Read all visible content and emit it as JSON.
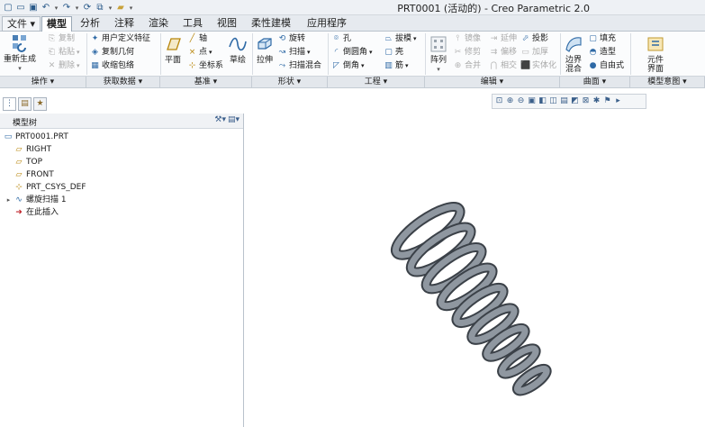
{
  "window": {
    "title": "PRT0001 (活动的) - Creo Parametric 2.0"
  },
  "quick_access": {
    "icons": [
      "new-icon",
      "open-icon",
      "save-icon",
      "undo-icon",
      "redo-icon",
      "regenerate-icon",
      "windows-icon",
      "close-icon"
    ]
  },
  "tabs": [
    {
      "label": "文件",
      "id": "file"
    },
    {
      "label": "模型",
      "id": "model"
    },
    {
      "label": "分析",
      "id": "analysis"
    },
    {
      "label": "注释",
      "id": "annotate"
    },
    {
      "label": "渲染",
      "id": "render"
    },
    {
      "label": "工具",
      "id": "tools"
    },
    {
      "label": "视图",
      "id": "view"
    },
    {
      "label": "柔性建模",
      "id": "flex"
    },
    {
      "label": "应用程序",
      "id": "apps"
    }
  ],
  "ribbon": {
    "operations": {
      "regenerate": "重新生成",
      "copy": "复制",
      "paste": "粘贴",
      "delete": "删除",
      "group_label": "操作"
    },
    "get_data": {
      "udf": "用户定义特征",
      "copy_geom": "复制几何",
      "shrinkwrap": "收缩包络",
      "group_label": "获取数据"
    },
    "datum": {
      "plane": "平面",
      "axis": "轴",
      "point": "点",
      "csys": "坐标系",
      "sketch": "草绘",
      "group_label": "基准"
    },
    "shapes": {
      "extrude": "拉伸",
      "revolve": "旋转",
      "sweep": "扫描",
      "swept_blend": "扫描混合",
      "group_label": "形状"
    },
    "engineering": {
      "hole": "孔",
      "round": "倒圆角",
      "chamfer": "倒角",
      "draft": "拔模",
      "shell": "壳",
      "rib": "筋",
      "group_label": "工程"
    },
    "editing": {
      "pattern": "阵列",
      "mirror": "镜像",
      "trim": "修剪",
      "merge": "合并",
      "extend": "延伸",
      "offset": "偏移",
      "intersect": "相交",
      "project": "投影",
      "thicken": "加厚",
      "solidify": "实体化",
      "group_label": "编辑"
    },
    "surfaces": {
      "boundary_blend": "边界混合",
      "fill": "填充",
      "style": "造型",
      "freestyle": "自由式",
      "group_label": "曲面"
    },
    "model_intent": {
      "component_interface": "元件界面",
      "group_label": "模型意图"
    }
  },
  "left_panel": {
    "tree_header": "模型树",
    "nodes": [
      {
        "label": "PRT0001.PRT",
        "icon": "part-icon"
      },
      {
        "label": "RIGHT",
        "icon": "datum-plane-icon"
      },
      {
        "label": "TOP",
        "icon": "datum-plane-icon"
      },
      {
        "label": "FRONT",
        "icon": "datum-plane-icon"
      },
      {
        "label": "PRT_CSYS_DEF",
        "icon": "csys-icon"
      },
      {
        "label": "螺旋扫描 1",
        "icon": "helical-sweep-icon"
      },
      {
        "label": "在此插入",
        "icon": "insert-here-arrow-icon"
      }
    ]
  },
  "colors": {
    "accent": "#2f6aa6",
    "insert_arrow": "#c0262c",
    "spring_face": "#8f97a0",
    "spring_dark": "#3b4148"
  }
}
